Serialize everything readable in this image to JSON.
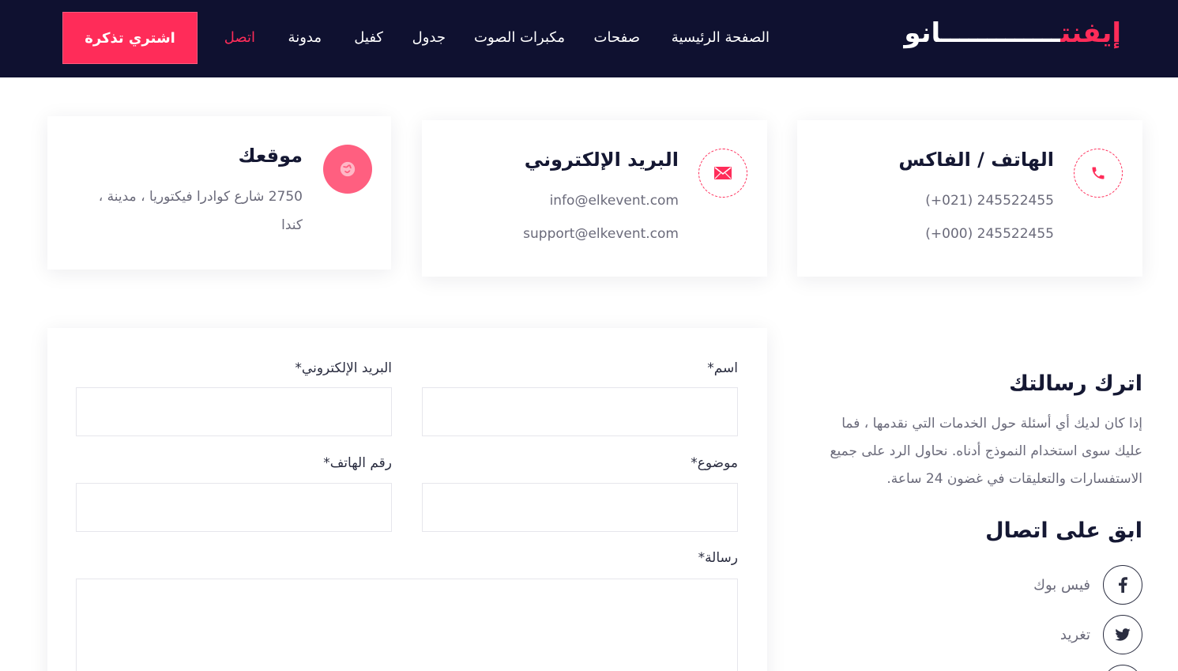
{
  "header": {
    "logo_main": "إيفنت",
    "logo_bar": "ـــــــــــــ",
    "logo_end": "انو",
    "nav": [
      {
        "label": "الصفحة الرئيسية",
        "active": false
      },
      {
        "label": "صفحات",
        "active": false
      },
      {
        "label": "مكبرات الصوت",
        "active": false
      },
      {
        "label": "جدول",
        "active": false
      },
      {
        "label": "كفيل",
        "active": false
      },
      {
        "label": "مدونة",
        "active": false
      },
      {
        "label": "اتصل",
        "active": true
      }
    ],
    "cta_label": "اشتري تذكرة"
  },
  "info_cards": {
    "phone": {
      "title": "الهاتف / الفاكس",
      "line1": "245522455 (021+)",
      "line2": "245522455 (000+)",
      "icon": "phone-icon"
    },
    "email": {
      "title": "البريد الإلكتروني",
      "line1": "info@elkevent.com",
      "line2": "support@elkevent.com",
      "icon": "envelope-icon"
    },
    "location": {
      "title": "موقعك",
      "line1": "2750 شارع كوادرا فيكتوريا ، مدينة ،",
      "line2": "كندا",
      "icon": "globe-icon"
    }
  },
  "contact_intro": {
    "title": "اترك رسالتك",
    "paragraph": "إذا كان لديك أي أسئلة حول الخدمات التي نقدمها ، فما عليك سوى استخدام النموذج أدناه. نحاول الرد على جميع الاستفسارات والتعليقات في غضون 24 ساعة."
  },
  "stay_connected": {
    "title": "ابق على اتصال",
    "links": [
      {
        "label": "فيس بوك",
        "icon": "facebook-icon"
      },
      {
        "label": "تغريد",
        "icon": "twitter-icon"
      }
    ]
  },
  "form": {
    "name_label": "اسم*",
    "email_label": "البريد الإلكتروني*",
    "subject_label": "موضوع*",
    "phone_label": "رقم الهاتف*",
    "message_label": "رسالة*",
    "name_value": "",
    "email_value": "",
    "subject_value": "",
    "phone_value": "",
    "message_value": ""
  },
  "colors": {
    "header_bg": "#0f1130",
    "accent": "#ff2c59",
    "text_dark": "#151833",
    "text_muted": "#6a6a7a"
  }
}
